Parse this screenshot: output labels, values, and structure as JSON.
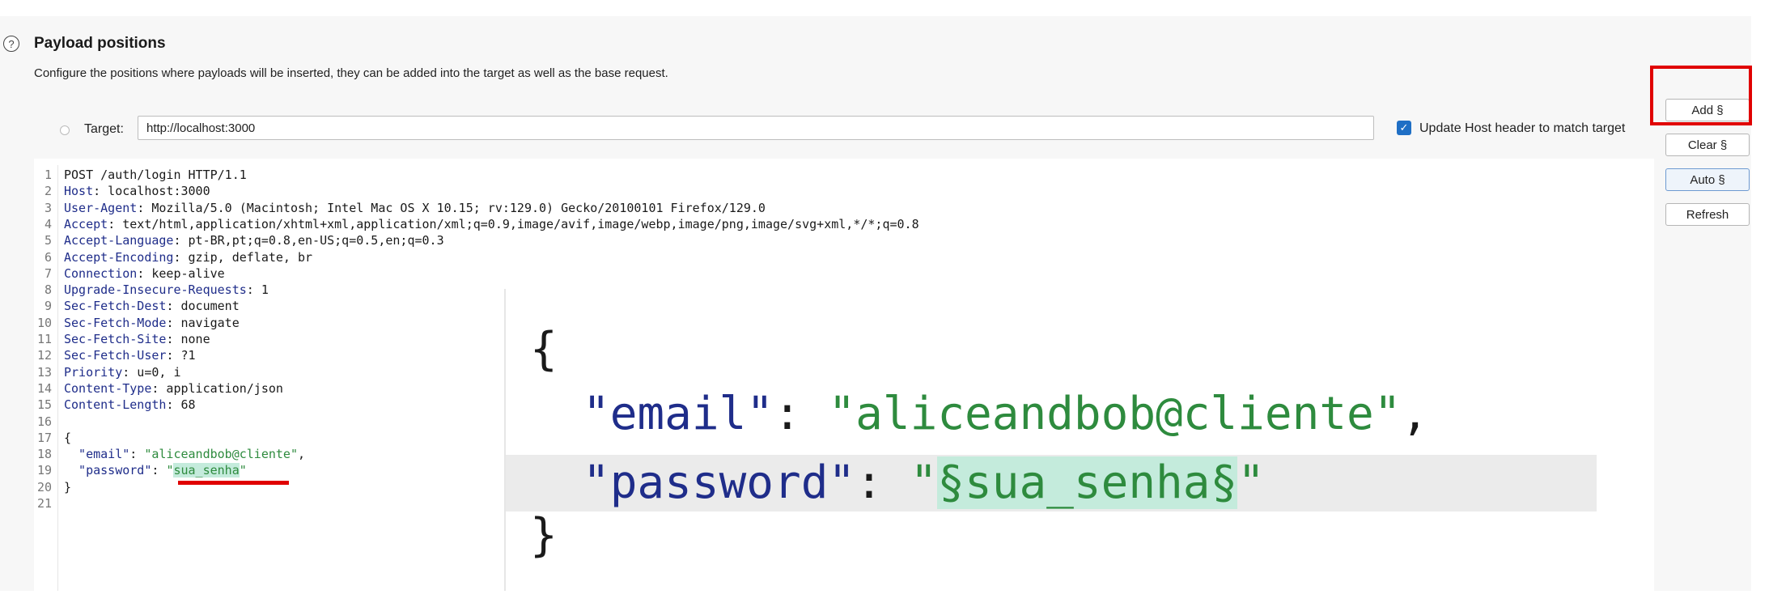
{
  "section": {
    "title": "Payload positions",
    "description": "Configure the positions where payloads will be inserted, they can be added into the target as well as the base request."
  },
  "target": {
    "label": "Target:",
    "value": "http://localhost:3000",
    "update_host_label": "Update Host header to match target",
    "update_host_checked": true
  },
  "buttons": {
    "add": "Add §",
    "clear": "Clear §",
    "auto": "Auto §",
    "refresh": "Refresh"
  },
  "request": {
    "lines": [
      {
        "n": "1",
        "raw": "POST /auth/login HTTP/1.1"
      },
      {
        "n": "2",
        "k": "Host",
        "v": ": localhost:3000"
      },
      {
        "n": "3",
        "k": "User-Agent",
        "v": ": Mozilla/5.0 (Macintosh; Intel Mac OS X 10.15; rv:129.0) Gecko/20100101 Firefox/129.0"
      },
      {
        "n": "4",
        "k": "Accept",
        "v": ": text/html,application/xhtml+xml,application/xml;q=0.9,image/avif,image/webp,image/png,image/svg+xml,*/*;q=0.8"
      },
      {
        "n": "5",
        "k": "Accept-Language",
        "v": ": pt-BR,pt;q=0.8,en-US;q=0.5,en;q=0.3"
      },
      {
        "n": "6",
        "k": "Accept-Encoding",
        "v": ": gzip, deflate, br"
      },
      {
        "n": "7",
        "k": "Connection",
        "v": ": keep-alive"
      },
      {
        "n": "8",
        "k": "Upgrade-Insecure-Requests",
        "v": ": 1"
      },
      {
        "n": "9",
        "k": "Sec-Fetch-Dest",
        "v": ": document"
      },
      {
        "n": "10",
        "k": "Sec-Fetch-Mode",
        "v": ": navigate"
      },
      {
        "n": "11",
        "k": "Sec-Fetch-Site",
        "v": ": none"
      },
      {
        "n": "12",
        "k": "Sec-Fetch-User",
        "v": ": ?1"
      },
      {
        "n": "13",
        "k": "Priority",
        "v": ": u=0, i"
      },
      {
        "n": "14",
        "k": "Content-Type",
        "v": ": application/json"
      },
      {
        "n": "15",
        "k": "Content-Length",
        "v": ": 68"
      },
      {
        "n": "16",
        "raw": ""
      },
      {
        "n": "17",
        "raw": "{"
      },
      {
        "n": "18",
        "jk": "  \"email\"",
        "js": "\"aliceandbob@cliente\"",
        "tail": ","
      },
      {
        "n": "19",
        "jk": "  \"password\"",
        "js_open": "\"",
        "js_hl": "sua_senha",
        "js_close": "\""
      },
      {
        "n": "20",
        "raw": "}"
      },
      {
        "n": "21",
        "raw": ""
      }
    ]
  },
  "zoom": {
    "open_brace": "{",
    "email_key": "\"email\"",
    "email_value": "\"aliceandbob@cliente\"",
    "email_tail": ",",
    "password_key": "\"password\"",
    "password_quote_open": "\"",
    "password_marked": "§sua_senha§",
    "password_quote_close": "\"",
    "close_brace": "}"
  }
}
